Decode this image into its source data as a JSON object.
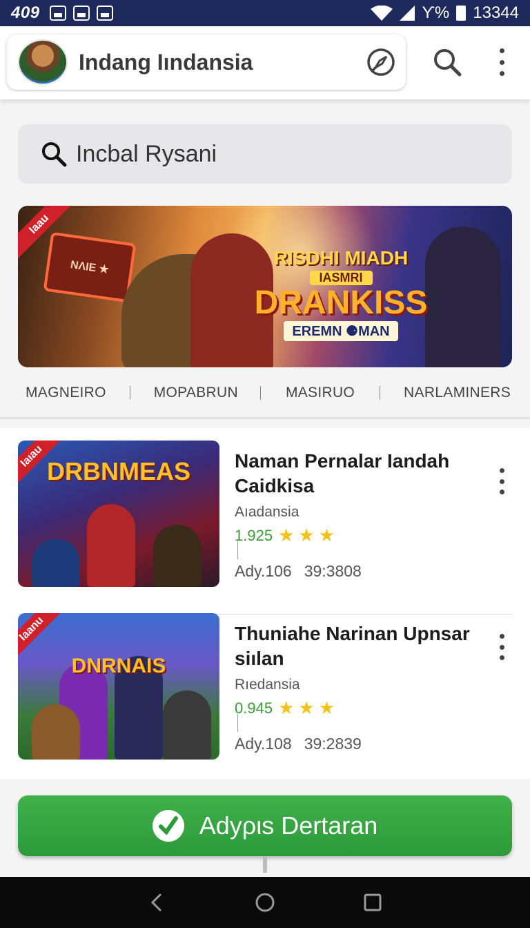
{
  "status_bar": {
    "time": "409",
    "signal_text": "ϒ%",
    "battery_text": "13344"
  },
  "app_bar": {
    "title": "Indang Iındansia",
    "icons": [
      "compass-icon",
      "search-icon",
      "more-vertical-icon"
    ]
  },
  "search": {
    "query": "Incbal Rysani"
  },
  "banner": {
    "ribbon": "Ιaau",
    "sign_text": "ΝΛΙЕ ★",
    "title_line1": "RISDHI MIADH",
    "title_line2": "IASMRI",
    "title_line3": "DRANKISS",
    "title_line4": "EREMN ⚈MAN"
  },
  "tabs": [
    "MAGNEIRO",
    "MOPABRUN",
    "MASIRUO",
    "NARLAMINERS"
  ],
  "items": [
    {
      "ribbon": "Ιaıau",
      "thumb_title": "DRBNMEAS",
      "title": "Naman Pernalar Iandah Caidkisa",
      "subtitle": "Aıadansia",
      "rating": "1.925",
      "stars": 3,
      "meta_left": "Ady.106",
      "meta_right": "39:3808"
    },
    {
      "ribbon": "Ιaanu",
      "thumb_title": "DNRNAIS",
      "title": "Thuniahe Narinan Upnsar siılan",
      "subtitle": "Rıedansia",
      "rating": "0.945",
      "stars": 3,
      "meta_left": "Ady.108",
      "meta_right": "39:2839"
    }
  ],
  "cta": {
    "label": "Adyριs Dertaran"
  },
  "colors": {
    "status_bar": "#1f2a5c",
    "cta_green": "#2d9a3a",
    "rating_green": "#3a9a3a",
    "star": "#f2c21a",
    "ribbon_red": "#d0202a"
  }
}
